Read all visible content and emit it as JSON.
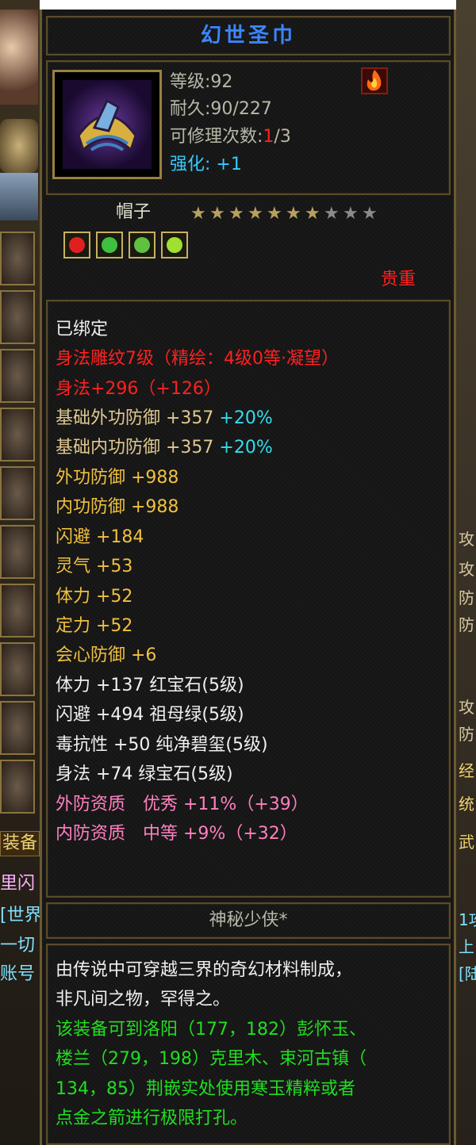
{
  "item": {
    "name": "幻世圣巾",
    "level_label": "等级:92",
    "durability_label": "耐久:90/227",
    "repair_prefix": "可修理次数:",
    "repair_used": "1",
    "repair_total": "/3",
    "enhance_label": "强化:",
    "enhance_value": "+1",
    "type": "帽子",
    "stars_total": 10,
    "stars_filled": 7,
    "rarity": "贵重",
    "colors": {
      "title": "#3a86ff",
      "red": "#ff2020",
      "cyan": "#33ddee",
      "gold": "#f0c040",
      "pink": "#ff80c0",
      "green": "#22dd22"
    }
  },
  "gems": [
    {
      "name": "红宝石",
      "color": "#e02020"
    },
    {
      "name": "祖母绿",
      "color": "#40c040"
    },
    {
      "name": "纯净碧玺",
      "color": "#60c040"
    },
    {
      "name": "绿宝石",
      "color": "#a0e030"
    }
  ],
  "attributes": {
    "bound": "已绑定",
    "carving": "身法雕纹7级（精绘：4级0等·凝望）",
    "carving_bonus": "身法+296（+126）",
    "base_ext_def": "基础外功防御 +357",
    "base_ext_def_pct": "+20%",
    "base_int_def": "基础内功防御 +357",
    "base_int_def_pct": "+20%",
    "lines_gold": [
      "外功防御 +988",
      "内功防御 +988",
      "闪避 +184",
      "灵气 +53",
      "体力 +52",
      "定力 +52",
      "会心防御 +6"
    ],
    "lines_white": [
      "体力 +137 红宝石(5级)",
      "闪避 +494 祖母绿(5级)",
      "毒抗性 +50 纯净碧玺(5级)",
      "身法 +74 绿宝石(5级)"
    ],
    "lines_pink": [
      "外防资质　优秀 +11%（+39）",
      "内防资质　中等 +9%（+32）"
    ]
  },
  "maker": "神秘少侠*",
  "description": {
    "line1": "由传说中可穿越三界的奇幻材料制成，",
    "line2": "非凡间之物，罕得之。",
    "green_lines": [
      "该装备可到洛阳（177，182）彭怀玉、",
      "楼兰（279，198）克里木、束河古镇（",
      "134，85）荆嵌实处使用寒玉精粹或者",
      "点金之箭进行极限打孔。"
    ]
  },
  "left_strip": {
    "labels": [
      "装备",
      "里闪",
      "[世界",
      "一切",
      "账号"
    ]
  },
  "right_strip": {
    "labels": [
      "攻",
      "攻",
      "防",
      "防",
      "攻",
      "防",
      "经",
      "统",
      "武",
      "1攻",
      "上",
      "[陆"
    ]
  }
}
